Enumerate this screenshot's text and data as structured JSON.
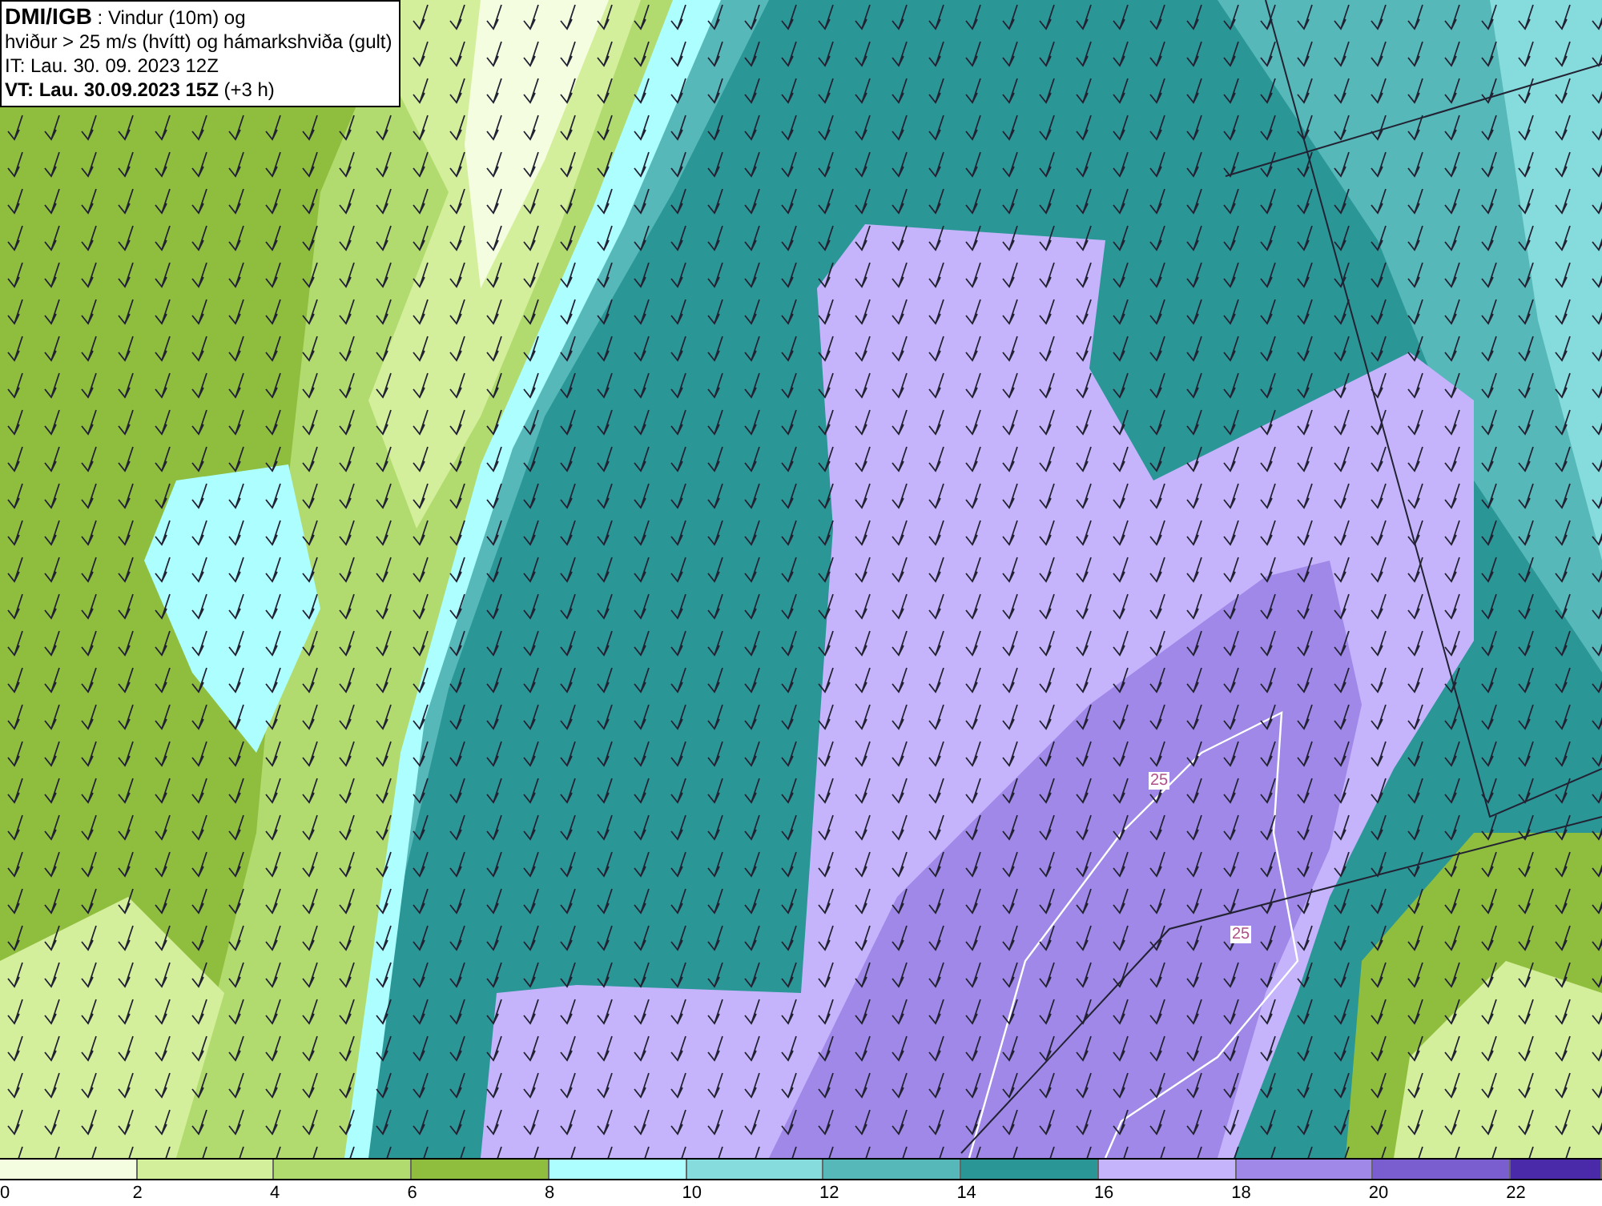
{
  "info_box": {
    "lines": [
      "**DMI/IGB** : Vindur (10m) og",
      "hviður > 25 m/s (hvítt) og hámarkshviða (gult)",
      "IT: Lau. 30. 09. 2023 12Z",
      "**VT: Lau. 30.09.2023 15Z** (+3 h)"
    ]
  },
  "contour_labels": [
    "25",
    "25"
  ],
  "legend": [
    {
      "label": "0",
      "color": "#f5fde0"
    },
    {
      "label": "2",
      "color": "#d4ef9c"
    },
    {
      "label": "4",
      "color": "#b2db6f"
    },
    {
      "label": "6",
      "color": "#8fbe3e"
    },
    {
      "label": "8",
      "color": "#adfefe"
    },
    {
      "label": "10",
      "color": "#86dcdc"
    },
    {
      "label": "12",
      "color": "#56b8b8"
    },
    {
      "label": "14",
      "color": "#2a9696"
    },
    {
      "label": "16",
      "color": "#c5b4fc"
    },
    {
      "label": "18",
      "color": "#9f88e8"
    },
    {
      "label": "20",
      "color": "#7a5ed0"
    },
    {
      "label": "22",
      "color": "#4a2aa8"
    }
  ]
}
